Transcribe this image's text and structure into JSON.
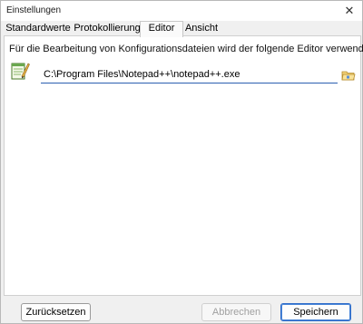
{
  "window": {
    "title": "Einstellungen",
    "close_glyph": "✕"
  },
  "tabs": [
    {
      "label": "Standardwerte",
      "active": false
    },
    {
      "label": "Protokollierung",
      "active": false
    },
    {
      "label": "Editor",
      "active": true
    },
    {
      "label": "Ansicht",
      "active": false
    }
  ],
  "editor_panel": {
    "description": "Für die Bearbeitung von Konfigurationsdateien wird der folgende Editor verwendet:",
    "editor_path": "C:\\Program Files\\Notepad++\\notepad++.exe",
    "editor_icon": "notepad-icon",
    "browse_icon": "folder-browse-icon"
  },
  "footer": {
    "reset_label": "Zurücksetzen",
    "cancel_label": "Abbrechen",
    "save_label": "Speichern"
  },
  "colors": {
    "field_underline": "#2b5fb0",
    "primary_border": "#2f6cc9",
    "disabled_text": "#a0a0a0"
  }
}
